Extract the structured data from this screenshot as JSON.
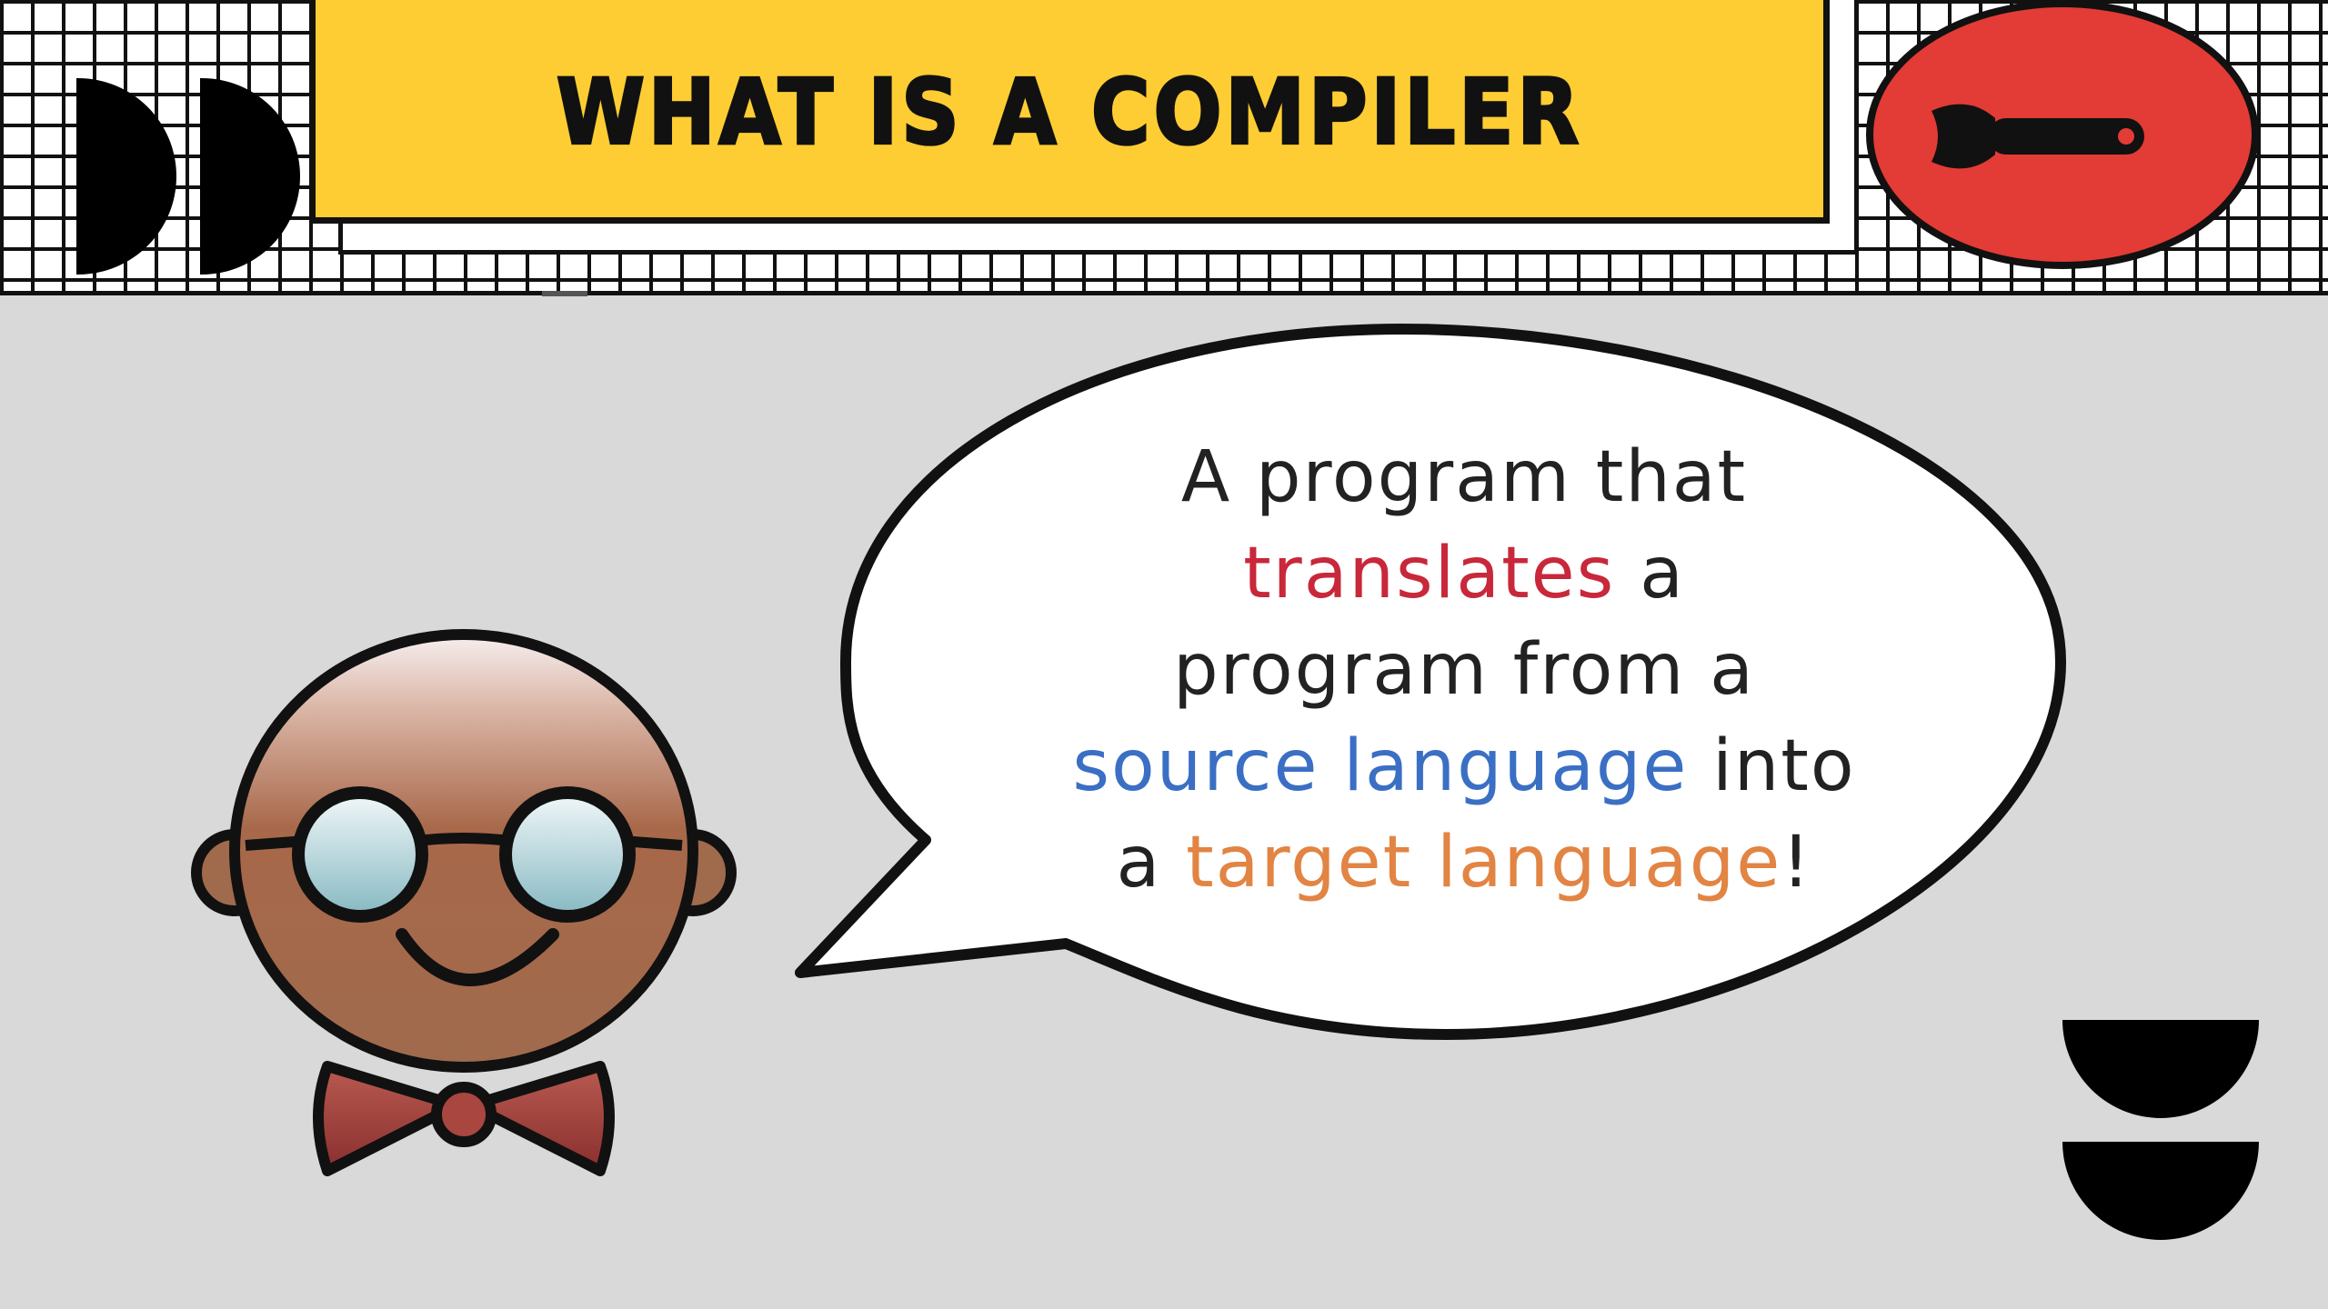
{
  "header": {
    "title": "WHAT IS A COMPILER"
  },
  "colors": {
    "title_bg": "#fecd33",
    "badge_bg": "#e33b35",
    "page_bg": "#d9d9d9",
    "highlight_red": "#c8283a",
    "highlight_blue": "#3a6fc4",
    "highlight_orange": "#e28443"
  },
  "icons": {
    "badge": "wrench-icon",
    "mascot": "professor-mascot-icon"
  },
  "bubble": {
    "line1": "A program that",
    "line2_highlight": "translates",
    "line2_rest": " a",
    "line3": "program from a",
    "line4_highlight": "source language",
    "line4_rest": " into",
    "line5_pre": "a ",
    "line5_highlight": "target language",
    "line5_post": "!"
  }
}
